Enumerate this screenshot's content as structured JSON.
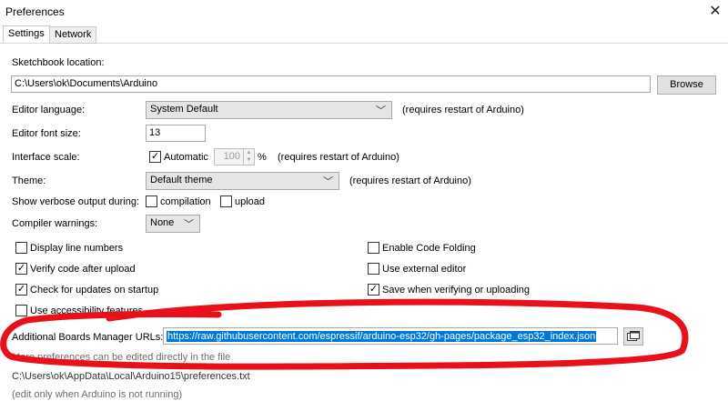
{
  "window": {
    "title": "Preferences"
  },
  "tabs": [
    {
      "label": "Settings"
    },
    {
      "label": "Network"
    }
  ],
  "sketchbook": {
    "label": "Sketchbook location:",
    "value": "C:\\Users\\ok\\Documents\\Arduino",
    "browse_label": "Browse"
  },
  "editor_language": {
    "label": "Editor language:",
    "value": "System Default",
    "note": "(requires restart of Arduino)"
  },
  "font_size": {
    "label": "Editor font size:",
    "value": "13"
  },
  "interface_scale": {
    "label": "Interface scale:",
    "automatic_label": "Automatic",
    "value": "100",
    "unit": "%",
    "note": "(requires restart of Arduino)"
  },
  "theme": {
    "label": "Theme:",
    "value": "Default theme",
    "note": "(requires restart of Arduino)"
  },
  "verbose": {
    "label": "Show verbose output during:",
    "compilation_label": "compilation",
    "upload_label": "upload"
  },
  "compiler_warnings": {
    "label": "Compiler warnings:",
    "value": "None"
  },
  "options_left": [
    {
      "label": "Display line numbers",
      "checked": false
    },
    {
      "label": "Verify code after upload",
      "checked": true
    },
    {
      "label": "Check for updates on startup",
      "checked": true
    },
    {
      "label": "Use accessibility features",
      "checked": false
    }
  ],
  "options_right": [
    {
      "label": "Enable Code Folding",
      "checked": false
    },
    {
      "label": "Use external editor",
      "checked": false
    },
    {
      "label": "Save when verifying or uploading",
      "checked": true
    }
  ],
  "boards_manager": {
    "label": "Additional Boards Manager URLs:",
    "value": "https://raw.githubusercontent.com/espressif/arduino-esp32/gh-pages/package_esp32_index.json"
  },
  "footer": {
    "more_prefs": "More preferences can be edited directly in the file",
    "prefs_path": "C:\\Users\\ok\\AppData\\Local\\Arduino15\\preferences.txt",
    "edit_note": "(edit only when Arduino is not running)"
  },
  "colors": {
    "annotation": "#e8101a",
    "selection": "#0078d7"
  }
}
